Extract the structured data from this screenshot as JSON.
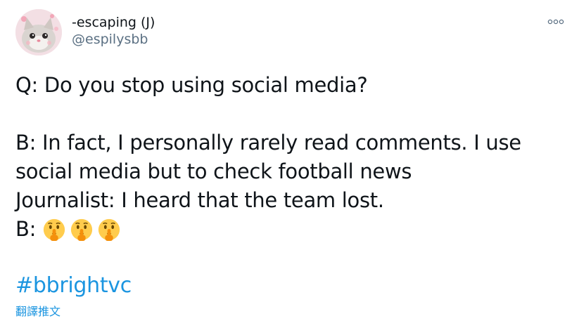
{
  "tweet": {
    "author": {
      "display_name": "-escaping (J)",
      "handle": "@espilysbb",
      "avatar_icon": "cat-avatar"
    },
    "menu_icon": "more-options-icon",
    "lines": [
      "Q: Do you stop using social media?",
      "",
      "B: In fact, I personally rarely read comments. I use",
      "social media but to check football news",
      "Journalist: I heard that the team lost."
    ],
    "emoji_line": {
      "prefix": "B:",
      "emojis": [
        "shushing-face-emoji",
        "shushing-face-emoji",
        "shushing-face-emoji"
      ]
    },
    "hashtag": "#bbrightvc",
    "translate_label": "翻譯推文",
    "colors": {
      "text": "#0f1419",
      "secondary": "#5b7083",
      "link": "#1b95e0"
    }
  }
}
